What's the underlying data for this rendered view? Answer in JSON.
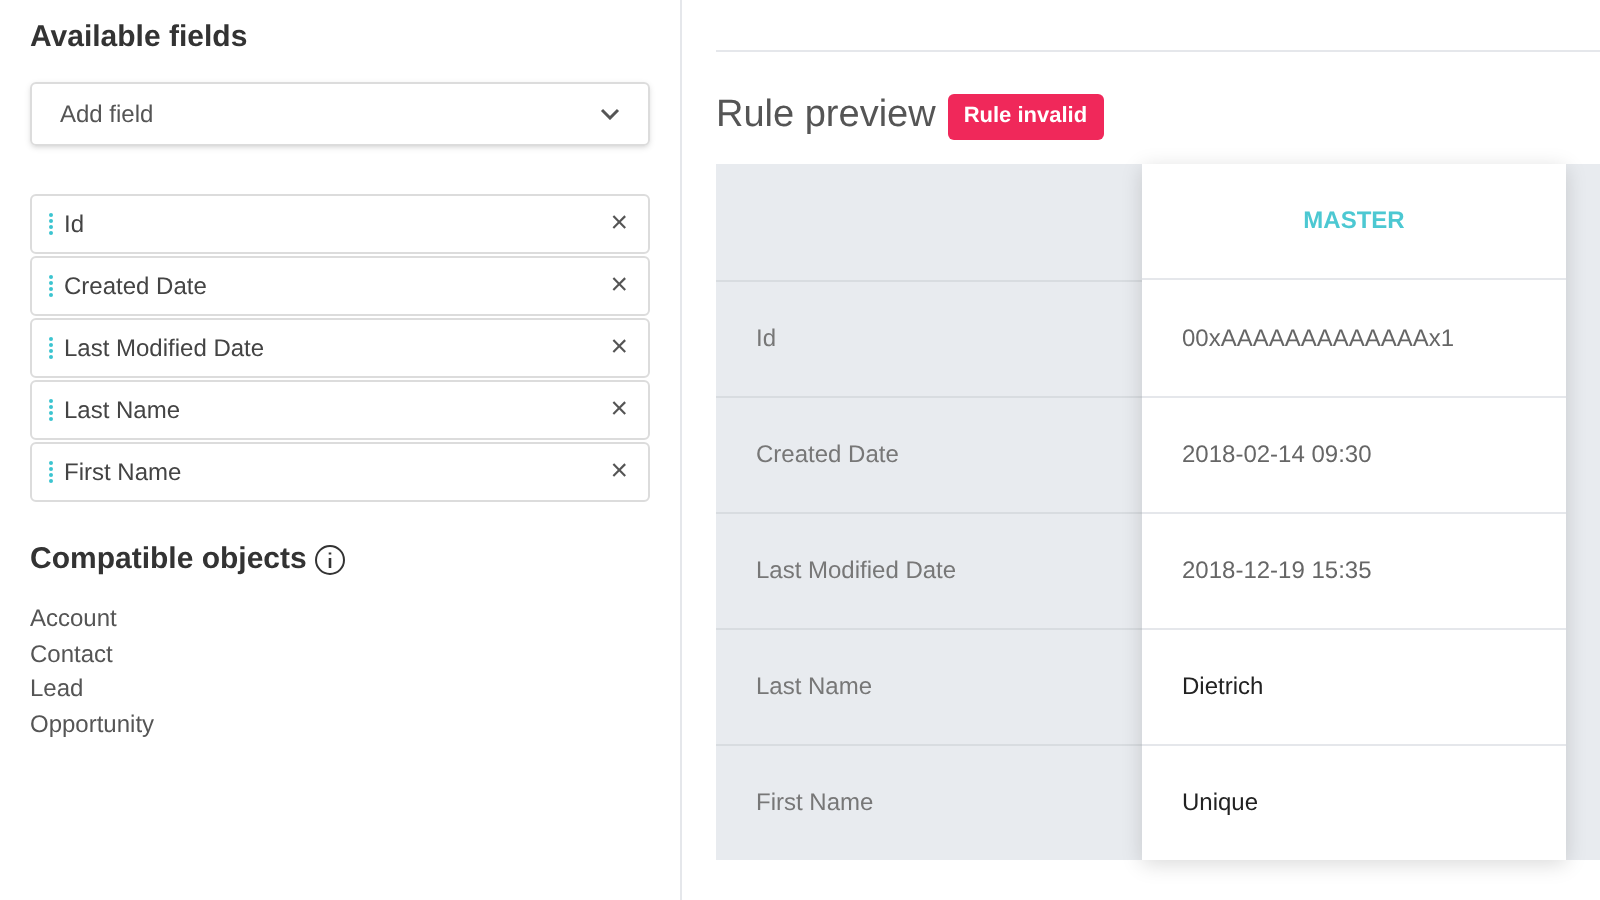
{
  "available_fields": {
    "title": "Available fields",
    "add_field": {
      "placeholder": "Add field"
    },
    "fields": [
      {
        "label": "Id",
        "remove": "×"
      },
      {
        "label": "Created Date",
        "remove": "×"
      },
      {
        "label": "Last Modified Date",
        "remove": "×"
      },
      {
        "label": "Last Name",
        "remove": "×"
      },
      {
        "label": "First Name",
        "remove": "×"
      }
    ]
  },
  "compatible_objects": {
    "title": "Compatible objects",
    "items": [
      "Account",
      "Contact",
      "Lead",
      "Opportunity"
    ]
  },
  "rule_preview": {
    "title": "Rule preview",
    "badge": "Rule invalid",
    "table": {
      "columns": [
        "MASTER"
      ],
      "rows": [
        {
          "field": "Id",
          "value": "00xAAAAAAAAAAAAAx1",
          "highlighted": false
        },
        {
          "field": "Created Date",
          "value": "2018-02-14 09:30",
          "highlighted": false
        },
        {
          "field": "Last Modified Date",
          "value": "2018-12-19 15:35",
          "highlighted": false
        },
        {
          "field": "Last Name",
          "value": "Dietrich",
          "highlighted": true
        },
        {
          "field": "First Name",
          "value": "Unique",
          "highlighted": true
        }
      ]
    }
  }
}
